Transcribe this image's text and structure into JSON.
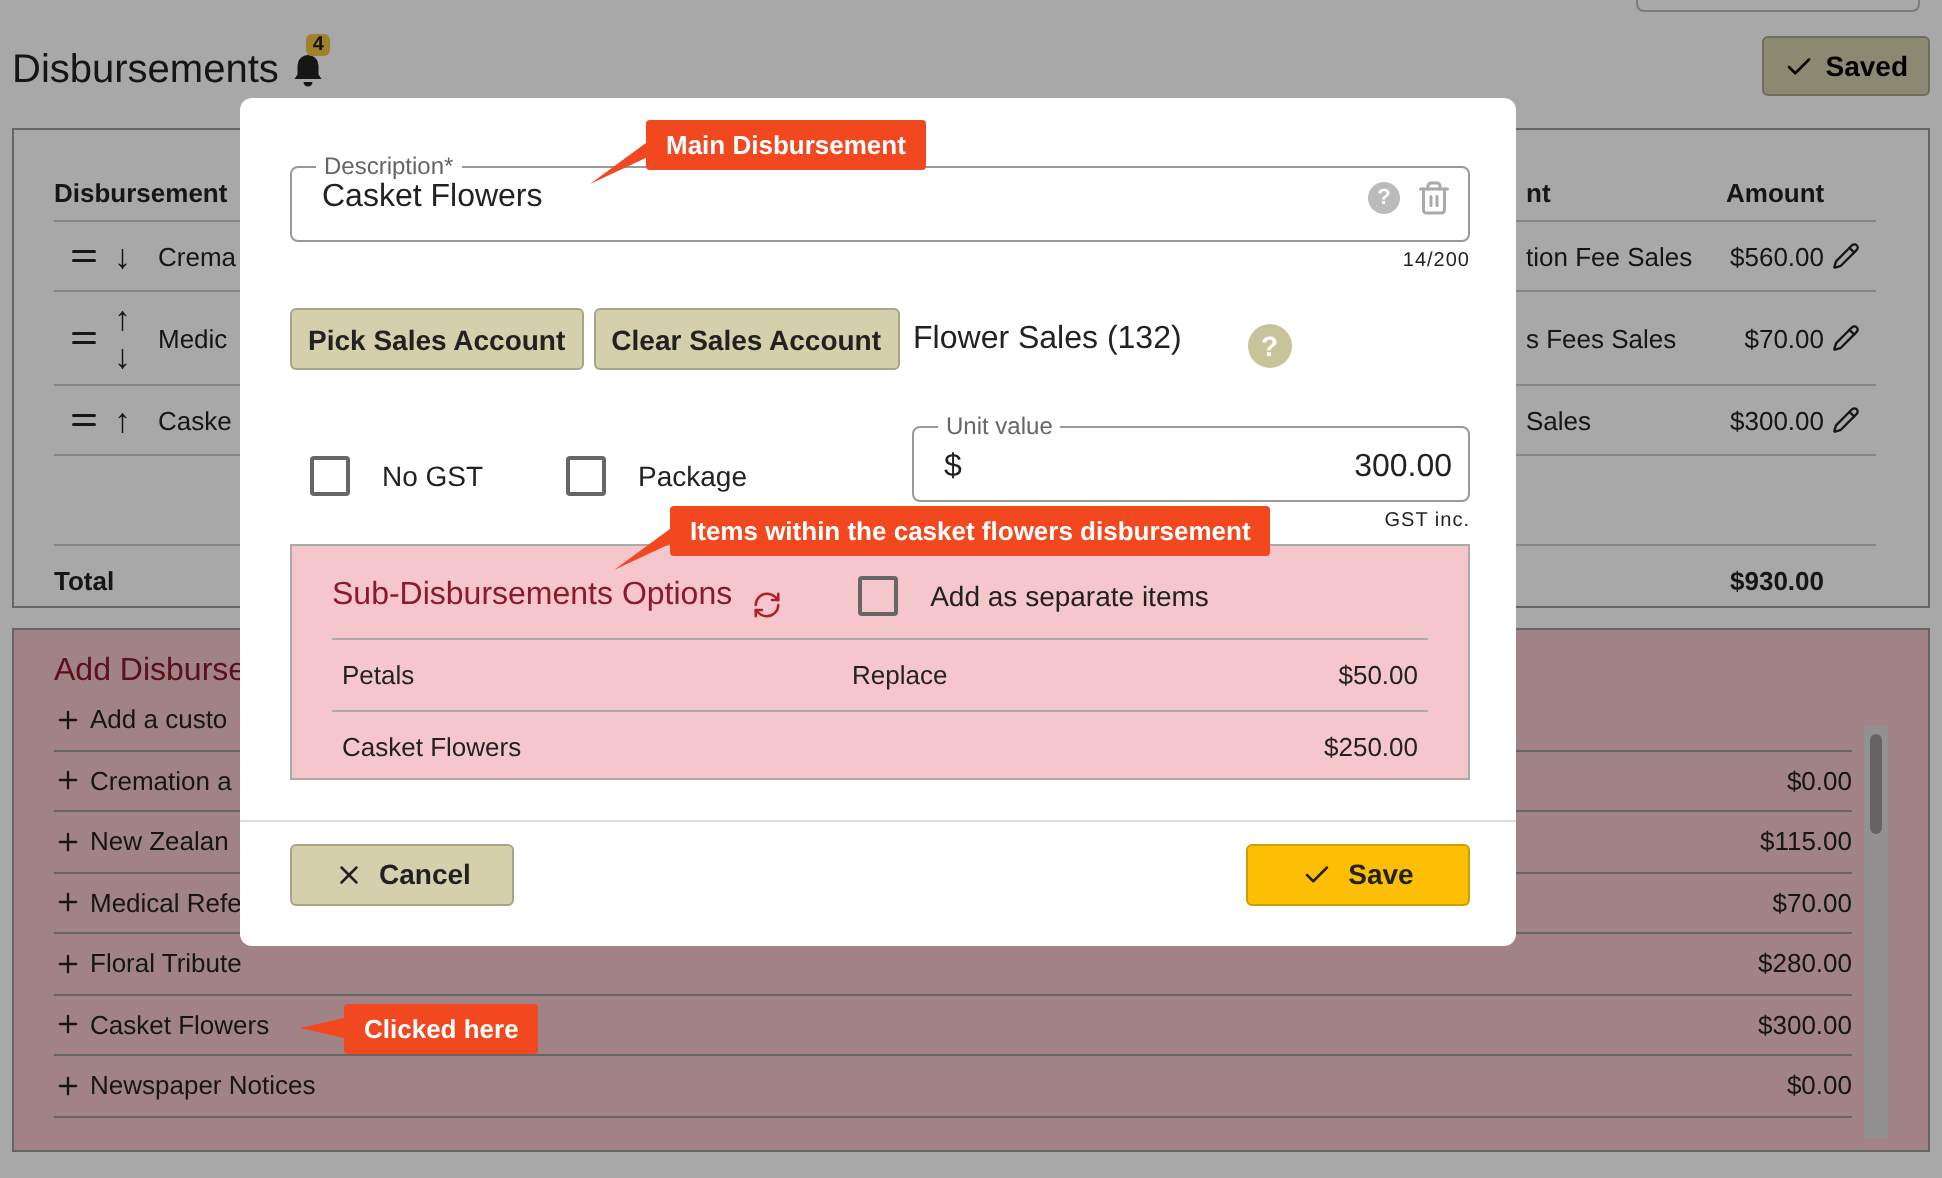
{
  "header": {
    "title": "Disbursements",
    "badge": "4",
    "saved_button": "Saved"
  },
  "table": {
    "columns": [
      "Disbursement",
      "nt",
      "Amount"
    ],
    "rows": [
      {
        "moves": [
          "↓"
        ],
        "name": "Crema",
        "account": "tion Fee Sales",
        "amount": "$560.00"
      },
      {
        "moves": [
          "↑",
          "↓"
        ],
        "name": "Medic",
        "account": "s Fees Sales",
        "amount": "$70.00"
      },
      {
        "moves": [
          "↑"
        ],
        "name": "Caske",
        "account": "Sales",
        "amount": "$300.00"
      }
    ],
    "total_label": "Total",
    "total": "$930.00"
  },
  "add_panel": {
    "title": "Add Disburse",
    "items": [
      {
        "name": "Add a custo"
      },
      {
        "name": "Cremation a",
        "amount": "$0.00"
      },
      {
        "name": "New Zealan",
        "amount": "$115.00"
      },
      {
        "name": "Medical Refe",
        "amount": "$70.00"
      },
      {
        "name": "Floral Tribute",
        "amount": "$280.00"
      },
      {
        "name": "Casket Flowers",
        "amount": "$300.00"
      },
      {
        "name": "Newspaper Notices",
        "amount": "$0.00"
      }
    ]
  },
  "dialog": {
    "description": {
      "label": "Description*",
      "value": "Casket Flowers",
      "counter": "14/200",
      "help": "?"
    },
    "pick_button": "Pick Sales Account",
    "clear_button": "Clear Sales Account",
    "account": "Flower Sales (132)",
    "account_help": "?",
    "options": [
      {
        "label": "No GST",
        "checked": false
      },
      {
        "label": "Package",
        "checked": false
      }
    ],
    "unit_value": {
      "label": "Unit value",
      "prefix": "$",
      "value": "300.00",
      "note": "GST inc."
    },
    "sub": {
      "title": "Sub-Disbursements Options",
      "separate": {
        "label": "Add as separate items",
        "checked": false
      },
      "rows": [
        {
          "name": "Petals",
          "action": "Replace",
          "amount": "$50.00"
        },
        {
          "name": "Casket Flowers",
          "amount": "$250.00"
        }
      ]
    },
    "cancel_button": "Cancel",
    "save_button": "Save"
  },
  "callouts": [
    {
      "text": "Main Disbursement"
    },
    {
      "text": "Items within the casket flowers disbursement"
    },
    {
      "text": "Clicked here"
    }
  ]
}
